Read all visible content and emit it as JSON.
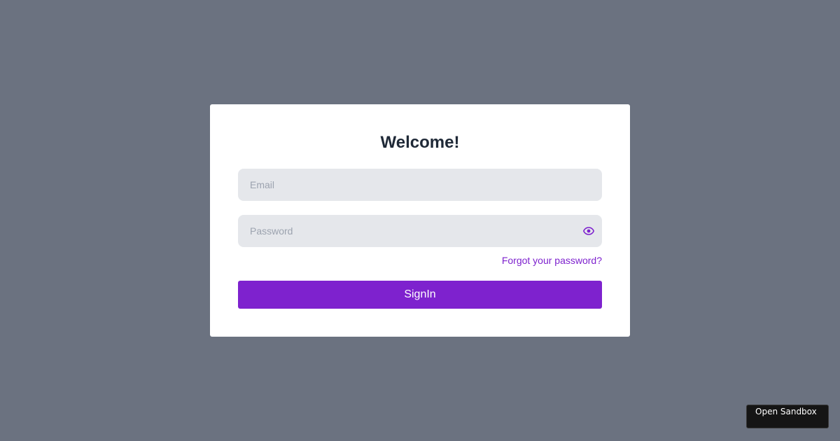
{
  "login": {
    "title": "Welcome!",
    "email_placeholder": "Email",
    "password_placeholder": "Password",
    "forgot_label": "Forgot your password?",
    "signin_label": "SignIn"
  },
  "footer": {
    "sandbox_label": "Open Sandbox"
  },
  "colors": {
    "background": "#6b7280",
    "card": "#ffffff",
    "accent": "#7e22ce",
    "input_bg": "#e5e7eb",
    "title_text": "#1f2937"
  },
  "icons": {
    "password_toggle": "eye-icon"
  }
}
